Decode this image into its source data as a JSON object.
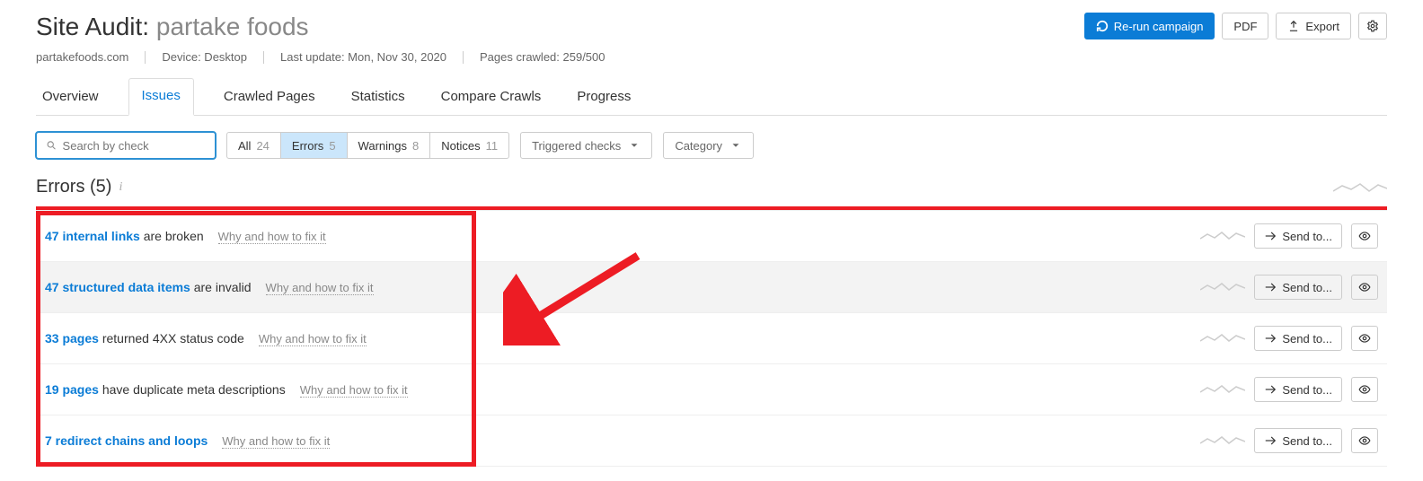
{
  "header": {
    "title_label": "Site Audit: ",
    "title_value": "partake foods",
    "rerun_label": "Re-run campaign",
    "pdf_label": "PDF",
    "export_label": "Export"
  },
  "meta": {
    "domain": "partakefoods.com",
    "device": "Device: Desktop",
    "last_update": "Last update: Mon, Nov 30, 2020",
    "pages_crawled": "Pages crawled: 259/500"
  },
  "tabs": [
    {
      "label": "Overview",
      "active": false
    },
    {
      "label": "Issues",
      "active": true
    },
    {
      "label": "Crawled Pages",
      "active": false
    },
    {
      "label": "Statistics",
      "active": false
    },
    {
      "label": "Compare Crawls",
      "active": false
    },
    {
      "label": "Progress",
      "active": false
    }
  ],
  "toolbar": {
    "search_placeholder": "Search by check",
    "pills": [
      {
        "label": "All",
        "count": "24",
        "selected": false
      },
      {
        "label": "Errors",
        "count": "5",
        "selected": true
      },
      {
        "label": "Warnings",
        "count": "8",
        "selected": false
      },
      {
        "label": "Notices",
        "count": "11",
        "selected": false
      }
    ],
    "triggered_label": "Triggered checks",
    "category_label": "Category"
  },
  "section": {
    "title": "Errors (5)"
  },
  "issues": [
    {
      "count_text": "47 internal links",
      "rest": " are broken",
      "fixit": "Why and how to fix it",
      "hover": false
    },
    {
      "count_text": "47 structured data items",
      "rest": " are invalid",
      "fixit": "Why and how to fix it",
      "hover": true
    },
    {
      "count_text": "33 pages",
      "rest": " returned 4XX status code",
      "fixit": "Why and how to fix it",
      "hover": false
    },
    {
      "count_text": "19 pages",
      "rest": " have duplicate meta descriptions",
      "fixit": "Why and how to fix it",
      "hover": false
    },
    {
      "count_text": "7 redirect chains and loops",
      "rest": "",
      "fixit": "Why and how to fix it",
      "hover": false
    }
  ],
  "sendto_label": "Send to..."
}
